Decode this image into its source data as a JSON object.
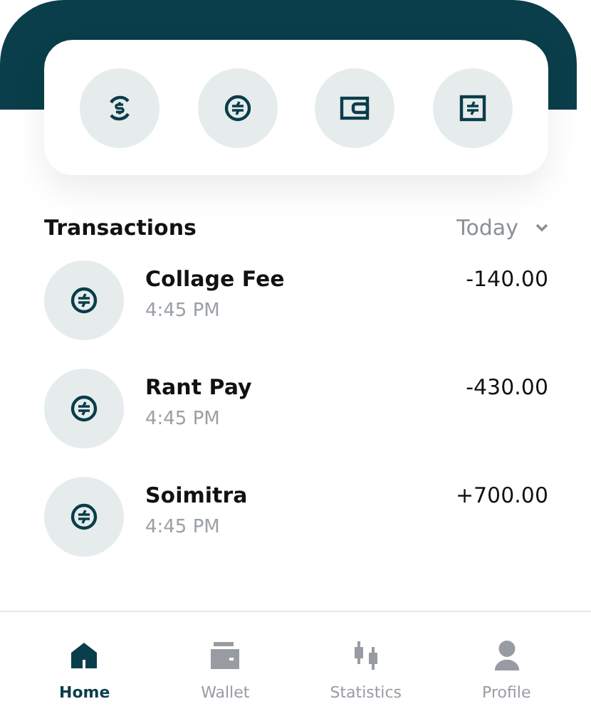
{
  "quick_actions": [
    {
      "kind": "exchange"
    },
    {
      "kind": "transfer"
    },
    {
      "kind": "wallet"
    },
    {
      "kind": "statement"
    }
  ],
  "transactions": {
    "title": "Transactions",
    "filter": "Today",
    "items": [
      {
        "name": "Collage Fee",
        "time": "4:45 PM",
        "amount": "-140.00"
      },
      {
        "name": "Rant Pay",
        "time": "4:45 PM",
        "amount": "-430.00"
      },
      {
        "name": "Soimitra",
        "time": "4:45 PM",
        "amount": "+700.00"
      }
    ]
  },
  "nav": [
    {
      "label": "Home",
      "kind": "home",
      "selected": true
    },
    {
      "label": "Wallet",
      "kind": "wallet",
      "selected": false
    },
    {
      "label": "Statistics",
      "kind": "statistics",
      "selected": false
    },
    {
      "label": "Profile",
      "kind": "profile",
      "selected": false
    }
  ]
}
